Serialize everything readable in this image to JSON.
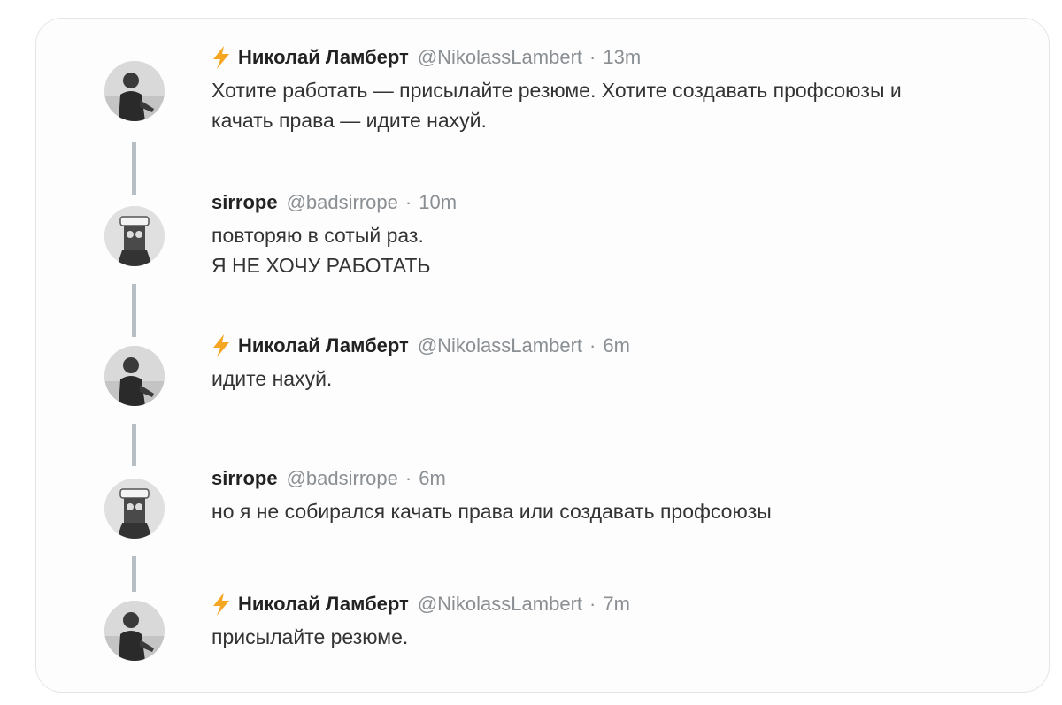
{
  "thread": [
    {
      "author": "Николай Ламберт",
      "handle": "@NikolassLambert",
      "time": "13m",
      "verified_icon": "lightning-icon",
      "text": "Хотите работать — присылайте резюме. Хотите создавать профсоюзы и\nкачать права — идите нахуй."
    },
    {
      "author": "sirrope",
      "handle": "@badsirrope",
      "time": "10m",
      "text": "повторяю в сотый раз.\nЯ НЕ ХОЧУ РАБОТАТЬ"
    },
    {
      "author": "Николай Ламберт",
      "handle": "@NikolassLambert",
      "time": "6m",
      "verified_icon": "lightning-icon",
      "text": "идите нахуй."
    },
    {
      "author": "sirrope",
      "handle": "@badsirrope",
      "time": "6m",
      "text": "но я не собирался качать права или создавать профсоюзы"
    },
    {
      "author": "Николай Ламберт",
      "handle": "@NikolassLambert",
      "time": "7m",
      "verified_icon": "lightning-icon",
      "text": "присылайте резюме."
    }
  ],
  "colors": {
    "thread_line": "#b8bfc4",
    "bolt": "#f5a623",
    "name": "#222222",
    "meta": "#8a8f94"
  }
}
